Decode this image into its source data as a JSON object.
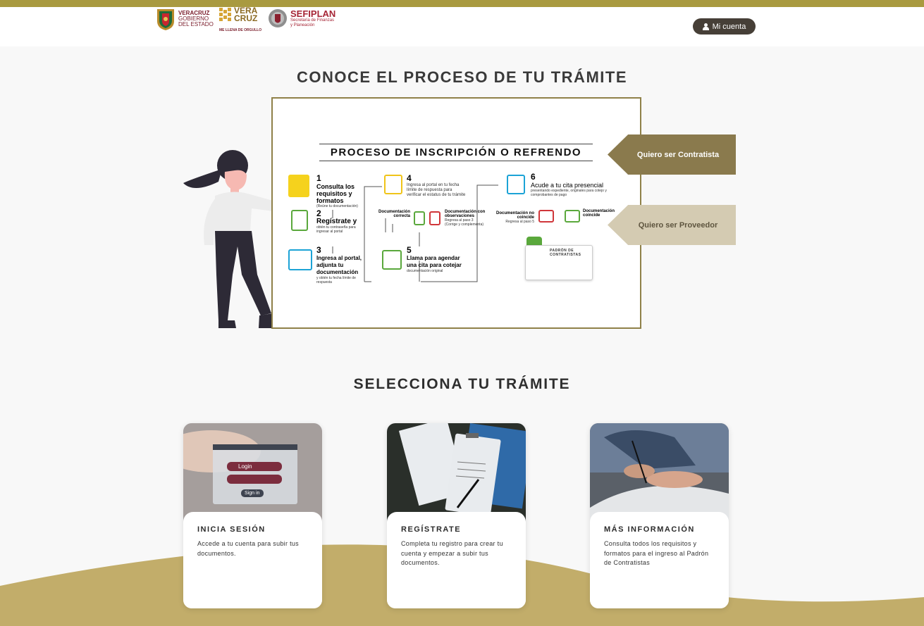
{
  "header": {
    "logos": {
      "veracruz_line1": "VERACRUZ",
      "veracruz_line2": "GOBIERNO",
      "veracruz_line3": "DEL ESTADO",
      "veracruz_brand": "VERA CRUZ",
      "veracruz_slogan": "ME LLENA DE ORGULLO",
      "sefiplan_title": "SEFIPLAN",
      "sefiplan_sub1": "Secretaría de Finanzas",
      "sefiplan_sub2": "y Planeación"
    },
    "account_label": "Mi cuenta"
  },
  "process_section": {
    "title": "CONOCE EL PROCESO DE TU TRÁMITE",
    "image": {
      "heading": "PROCESO DE INSCRIPCIÓN O REFRENDO",
      "steps": [
        {
          "num": "1",
          "label": "Consulta los requisitos y formatos",
          "note": "(Reúne tu documentación)"
        },
        {
          "num": "2",
          "label": "Regístrate y",
          "note": "obtén tu contraseña para ingresar al portal"
        },
        {
          "num": "3",
          "label": "Ingresa al portal, adjunta tu documentación",
          "note": "y obtén tu fecha límite de respuesta"
        },
        {
          "num": "4",
          "label": "Ingresa al portal en tu fecha límite de respuesta para verificar el estatus de tu trámite",
          "note": ""
        },
        {
          "num": "5",
          "label": "Llama para agendar una cita para cotejar",
          "note": "documentación original"
        },
        {
          "num": "6",
          "label": "Acude a tu cita presencial",
          "note": "presentando expediente, originales para cotejo y comprobantes de pago"
        }
      ],
      "branch_ok": "Documentación correcta",
      "branch_obs": "Documentación con observaciones",
      "branch_obs_note": "Regresa al paso 3 (Corrige y complementa)",
      "branch_no": "Documentación no coincide",
      "branch_no_note": "Regresa al paso 5",
      "branch_yes": "Documentación coincide",
      "padron_label": "PADRÓN DE CONTRATISTAS"
    },
    "side_buttons": {
      "contratista": "Quiero ser Contratista",
      "proveedor": "Quiero ser Proveedor"
    }
  },
  "tramite_section": {
    "title": "SELECCIONA TU TRÁMITE",
    "cards": [
      {
        "title": "INICIA SESIÓN",
        "desc": "Accede a tu cuenta para subir tus documentos.",
        "img_login": "Login",
        "img_signin": "Sign in"
      },
      {
        "title": "REGÍSTRATE",
        "desc": "Completa tu registro para crear tu cuenta y empezar a subir tus documentos."
      },
      {
        "title": "MÁS INFORMACIÓN",
        "desc": "Consulta todos los requisitos y formatos para el ingreso al Padrón de Contratistas"
      }
    ]
  },
  "colors": {
    "brand_gold": "#a99a40",
    "brand_dark": "#463f37",
    "contratista_button": "#8a7a4d",
    "proveedor_button": "#d4cbb2",
    "wave": "#c2ad6a"
  }
}
